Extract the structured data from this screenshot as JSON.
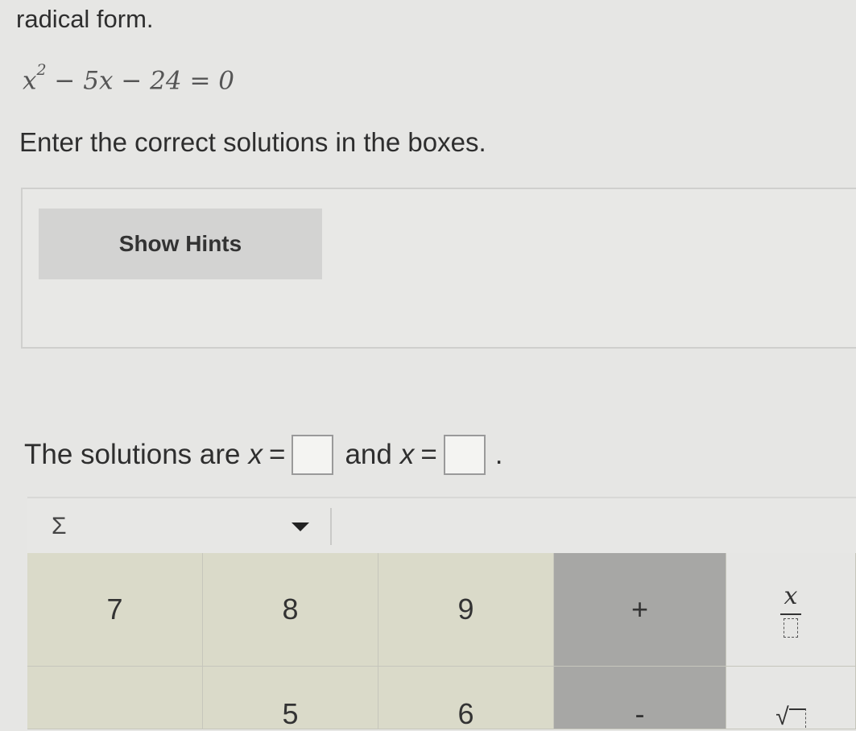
{
  "question": {
    "prompt_tail": "radical form.",
    "equation": {
      "base": "x",
      "exponent": "2",
      "rest": " − 5x − 24 = 0"
    },
    "instruction": "Enter the correct solutions in the boxes."
  },
  "hints": {
    "button_label": "Show Hints"
  },
  "answer": {
    "lead": "The solutions are",
    "var": "x",
    "eq": "=",
    "joiner": "and",
    "period": "."
  },
  "toolbar": {
    "palette_icon": "Σ"
  },
  "keypad": {
    "row1": [
      "7",
      "8",
      "9",
      "+"
    ],
    "fraction_top": "x",
    "row2_partial": [
      "",
      "5",
      "6",
      "-"
    ],
    "sqrt_glyph": "√"
  }
}
